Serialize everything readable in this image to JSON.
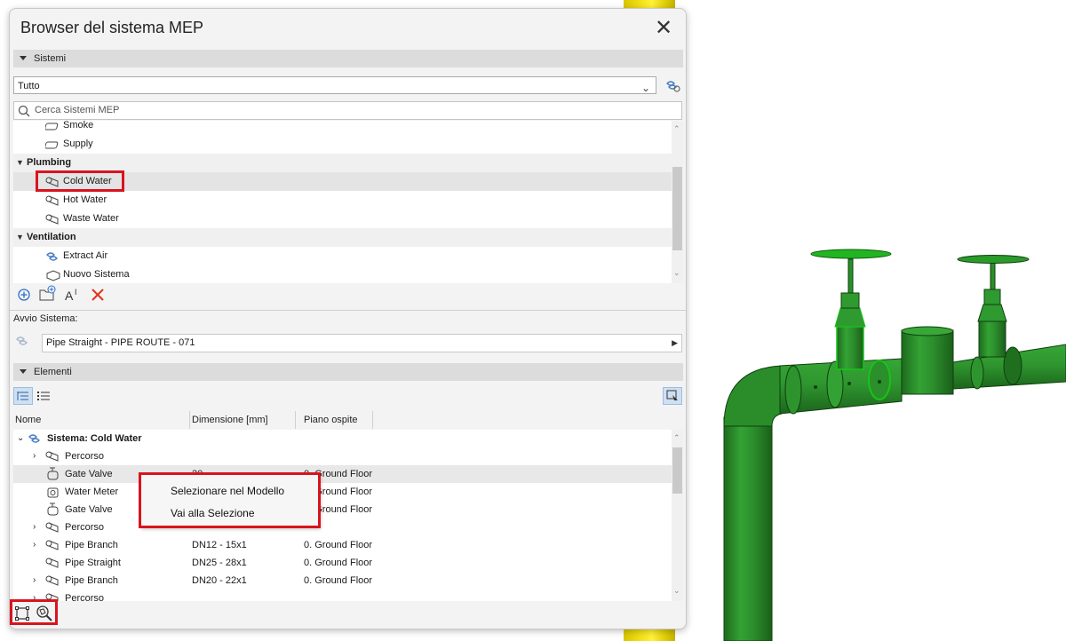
{
  "window": {
    "title": "Browser del sistema MEP"
  },
  "sections": {
    "systems": "Sistemi",
    "elements": "Elementi"
  },
  "filter": {
    "value": "Tutto"
  },
  "search": {
    "placeholder": "Cerca Sistemi MEP"
  },
  "systems_tree": {
    "items": [
      {
        "label": "Smoke"
      },
      {
        "label": "Supply"
      },
      {
        "label": "Plumbing"
      },
      {
        "label": "Cold Water"
      },
      {
        "label": "Hot Water"
      },
      {
        "label": "Waste Water"
      },
      {
        "label": "Ventilation"
      },
      {
        "label": "Extract Air"
      },
      {
        "label": "Nuovo Sistema"
      }
    ]
  },
  "system_start": {
    "label": "Avvio Sistema:",
    "value": "Pipe Straight - PIPE ROUTE - 071"
  },
  "elements": {
    "columns": [
      "Nome",
      "Dimensione [mm]",
      "Piano ospite"
    ],
    "rows": [
      {
        "name": "Sistema: Cold Water",
        "size": "",
        "floor": ""
      },
      {
        "name": "Percorso",
        "size": "",
        "floor": ""
      },
      {
        "name": "Gate Valve",
        "size": "20",
        "floor": "0. Ground Floor"
      },
      {
        "name": "Water Meter",
        "size": "",
        "floor": "0. Ground Floor"
      },
      {
        "name": "Gate Valve",
        "size": "",
        "floor": "0. Ground Floor"
      },
      {
        "name": "Percorso",
        "size": "",
        "floor": ""
      },
      {
        "name": "Pipe Branch",
        "size": "DN12 - 15x1",
        "floor": "0. Ground Floor"
      },
      {
        "name": "Pipe Straight",
        "size": "DN25 - 28x1",
        "floor": "0. Ground Floor"
      },
      {
        "name": "Pipe Branch",
        "size": "DN20 - 22x1",
        "floor": "0. Ground Floor"
      },
      {
        "name": "Percorso",
        "size": "",
        "floor": ""
      }
    ]
  },
  "context_menu": {
    "items": [
      "Selezionare nel Modello",
      "Vai alla Selezione"
    ]
  },
  "colors": {
    "highlight": "#d8141e",
    "pipe": "#2e8b2e",
    "pipe_selected": "#18c418",
    "yellow_pipe": "#f4e21a"
  }
}
